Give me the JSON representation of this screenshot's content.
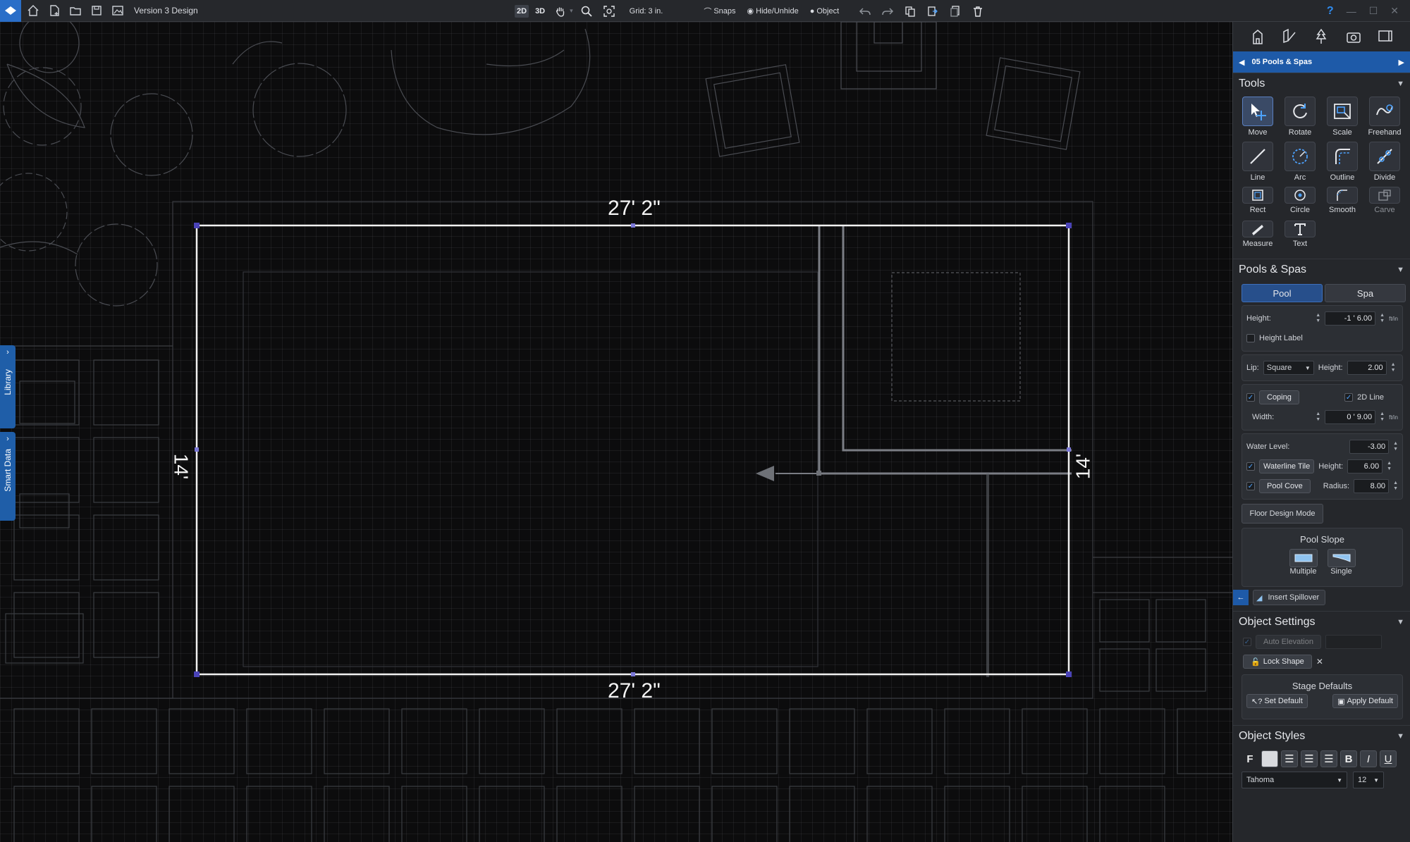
{
  "app": {
    "design_title": "Version 3 Design",
    "colors": {
      "accent": "#1e5aa8",
      "panel_bg": "#25272b",
      "canvas_bg": "#0c0c0d",
      "topbar_bg": "#26282c"
    }
  },
  "toolbar": {
    "left_icons": [
      "home-icon",
      "new-file-icon",
      "open-folder-icon",
      "save-icon",
      "image-icon"
    ],
    "view_2d": "2D",
    "view_3d": "3D",
    "grid": "Grid: 3 in.",
    "snaps": "Snaps",
    "hide_unhide": "Hide/Unhide",
    "object": "Object",
    "help": "?"
  },
  "canvas": {
    "dimension_top": "27' 2\"",
    "dimension_bottom": "27' 2\"",
    "dimension_left": "14'",
    "dimension_right": "14'"
  },
  "left_tabs": {
    "library": "Library",
    "smart_data": "Smart Data"
  },
  "panel": {
    "stage_icons": [
      "house-icon",
      "plan-edit-icon",
      "tree-icon",
      "camera-icon",
      "presentation-icon"
    ],
    "stage_name": "05 Pools & Spas",
    "tools": {
      "title": "Tools",
      "items": [
        {
          "label": "Move",
          "icon": "move-icon"
        },
        {
          "label": "Rotate",
          "icon": "rotate-icon"
        },
        {
          "label": "Scale",
          "icon": "scale-icon"
        },
        {
          "label": "Freehand",
          "icon": "freehand-icon"
        },
        {
          "label": "Line",
          "icon": "line-icon"
        },
        {
          "label": "Arc",
          "icon": "arc-icon"
        },
        {
          "label": "Outline",
          "icon": "outline-icon"
        },
        {
          "label": "Divide",
          "icon": "divide-icon"
        },
        {
          "label": "Rect",
          "icon": "rect-icon"
        },
        {
          "label": "Circle",
          "icon": "circle-icon"
        },
        {
          "label": "Smooth",
          "icon": "smooth-icon"
        },
        {
          "label": "Carve",
          "icon": "carve-icon"
        },
        {
          "label": "Measure",
          "icon": "measure-icon"
        },
        {
          "label": "Text",
          "icon": "text-icon"
        }
      ]
    },
    "pools": {
      "title": "Pools & Spas",
      "pool_tab": "Pool",
      "spa_tab": "Spa",
      "height_label": "Height:",
      "height_value": "-1 ' 6.00",
      "unit_ftin": "ft/in",
      "height_label_check": "Height Label",
      "lip_label": "Lip:",
      "lip_value": "Square",
      "lip_height_label": "Height:",
      "lip_height_value": "2.00",
      "coping": "Coping",
      "line_2d": "2D Line",
      "width_label": "Width:",
      "width_value": "0 ' 9.00",
      "water_level_label": "Water Level:",
      "water_level_value": "-3.00",
      "waterline_tile": "Waterline Tile",
      "wt_height_label": "Height:",
      "wt_height_value": "6.00",
      "pool_cove": "Pool Cove",
      "radius_label": "Radius:",
      "radius_value": "8.00",
      "floor_design_mode": "Floor Design Mode",
      "pool_slope": "Pool Slope",
      "slope_multiple": "Multiple",
      "slope_single": "Single",
      "insert_spillover": "Insert Spillover"
    },
    "object_settings": {
      "title": "Object Settings",
      "auto_elevation": "Auto Elevation",
      "lock_shape": "Lock Shape",
      "stage_defaults": "Stage Defaults",
      "set_default": "Set Default",
      "apply_default": "Apply Default"
    },
    "object_styles": {
      "title": "Object Styles",
      "fill_label": "F",
      "bold": "B",
      "italic": "I",
      "underline": "U",
      "font": "Tahoma",
      "size": "12"
    }
  }
}
